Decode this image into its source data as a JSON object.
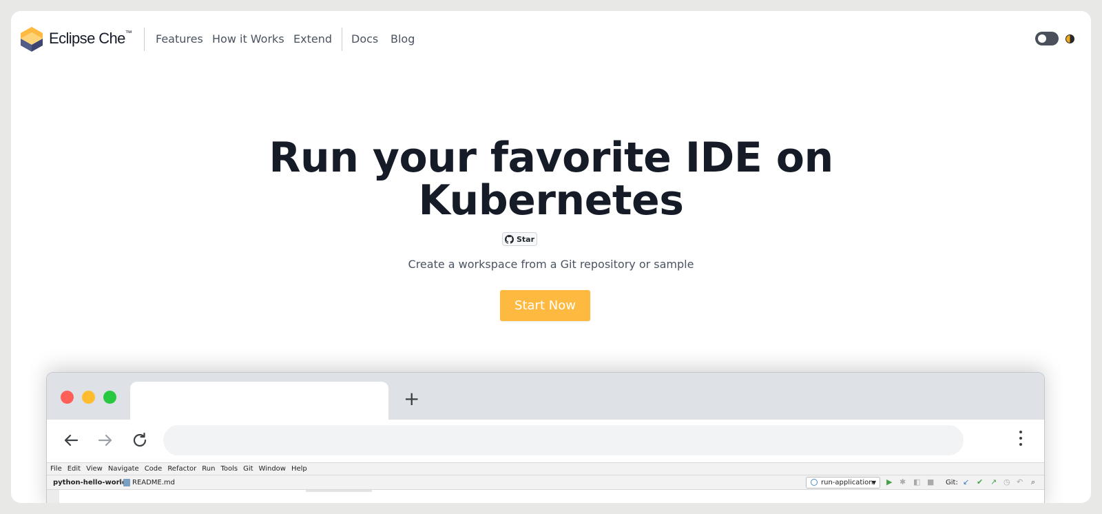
{
  "nav": {
    "brand": "Eclipse Che",
    "brand_tm": "™",
    "links": [
      "Features",
      "How it Works",
      "Extend",
      "Docs",
      "Blog"
    ]
  },
  "hero": {
    "title_line1": "Run your favorite IDE on",
    "title_line2": "Kubernetes",
    "star_label": "Star",
    "subtitle": "Create a workspace from a Git repository or sample",
    "cta_label": "Start Now"
  },
  "colors": {
    "accent": "#fdb940",
    "logo_top": "#fdb940",
    "logo_bottom": "#525c86",
    "traffic_red": "#fe5f57",
    "traffic_yellow": "#febc2e",
    "traffic_green": "#28c840"
  },
  "ide": {
    "menu": [
      "File",
      "Edit",
      "View",
      "Navigate",
      "Code",
      "Refactor",
      "Run",
      "Tools",
      "Git",
      "Window",
      "Help"
    ],
    "project": "python-hello-world",
    "file": "README.md",
    "run_config": "run-application",
    "git_label": "Git:"
  }
}
